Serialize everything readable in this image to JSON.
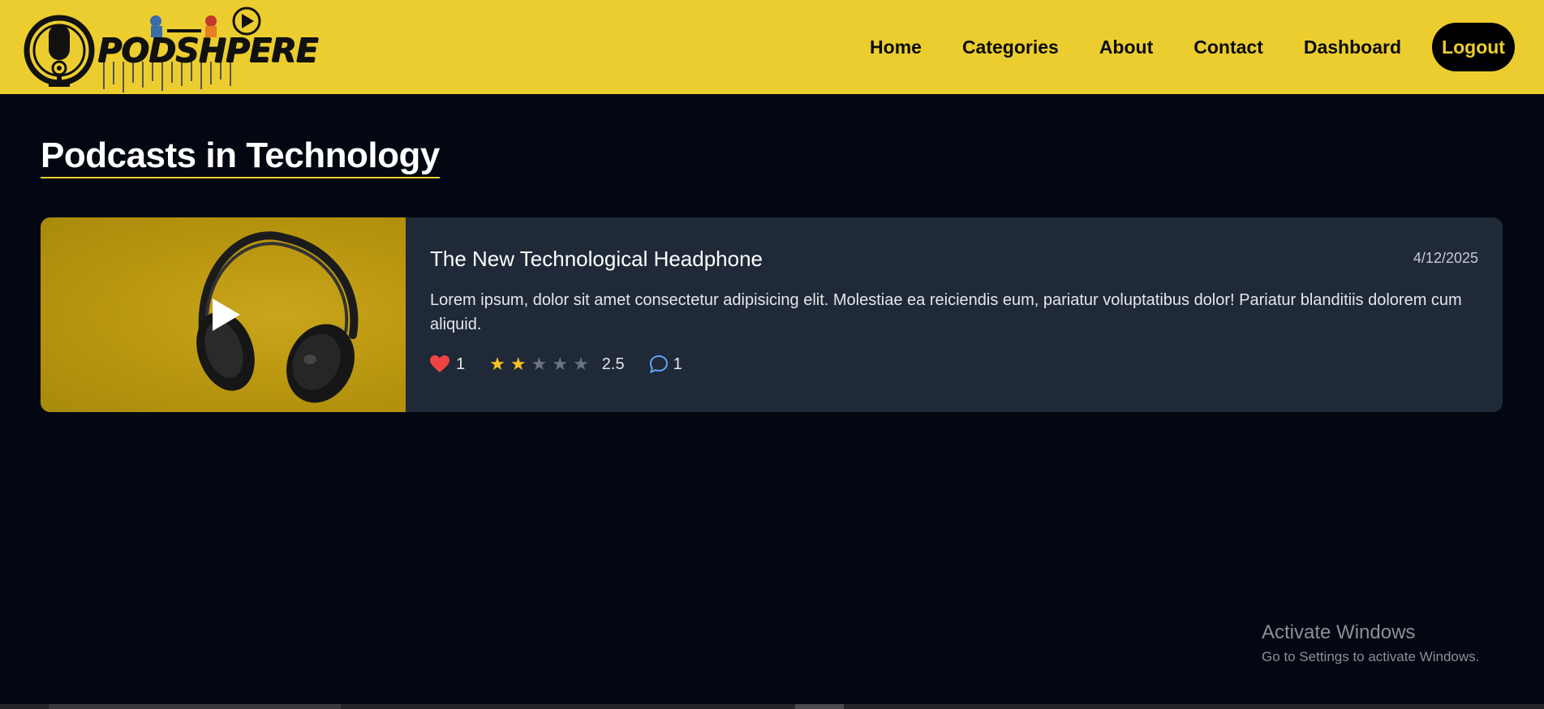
{
  "header": {
    "logo_text": "PODSHPERE",
    "nav": {
      "home": "Home",
      "categories": "Categories",
      "about": "About",
      "contact": "Contact",
      "dashboard": "Dashboard",
      "logout": "Logout"
    },
    "colors": {
      "background": "#eccd2f",
      "logout_bg": "#000000",
      "logout_text": "#eccd2f"
    }
  },
  "main": {
    "title": "Podcasts in Technology",
    "podcasts": [
      {
        "title": "The New Technological Headphone",
        "date": "4/12/2025",
        "description": "Lorem ipsum, dolor sit amet consectetur adipisicing elit. Molestiae ea reiciendis eum, pariatur voluptatibus dolor! Pariatur blanditiis dolorem cum aliquid.",
        "likes": "1",
        "rating": "2.5",
        "rating_stars_filled": 2,
        "rating_stars_total": 5,
        "comments": "1",
        "thumbnail_icon": "headphones-image",
        "play_icon": "play-icon"
      }
    ]
  },
  "watermark": {
    "title": "Activate Windows",
    "subtitle": "Go to Settings to activate Windows."
  }
}
